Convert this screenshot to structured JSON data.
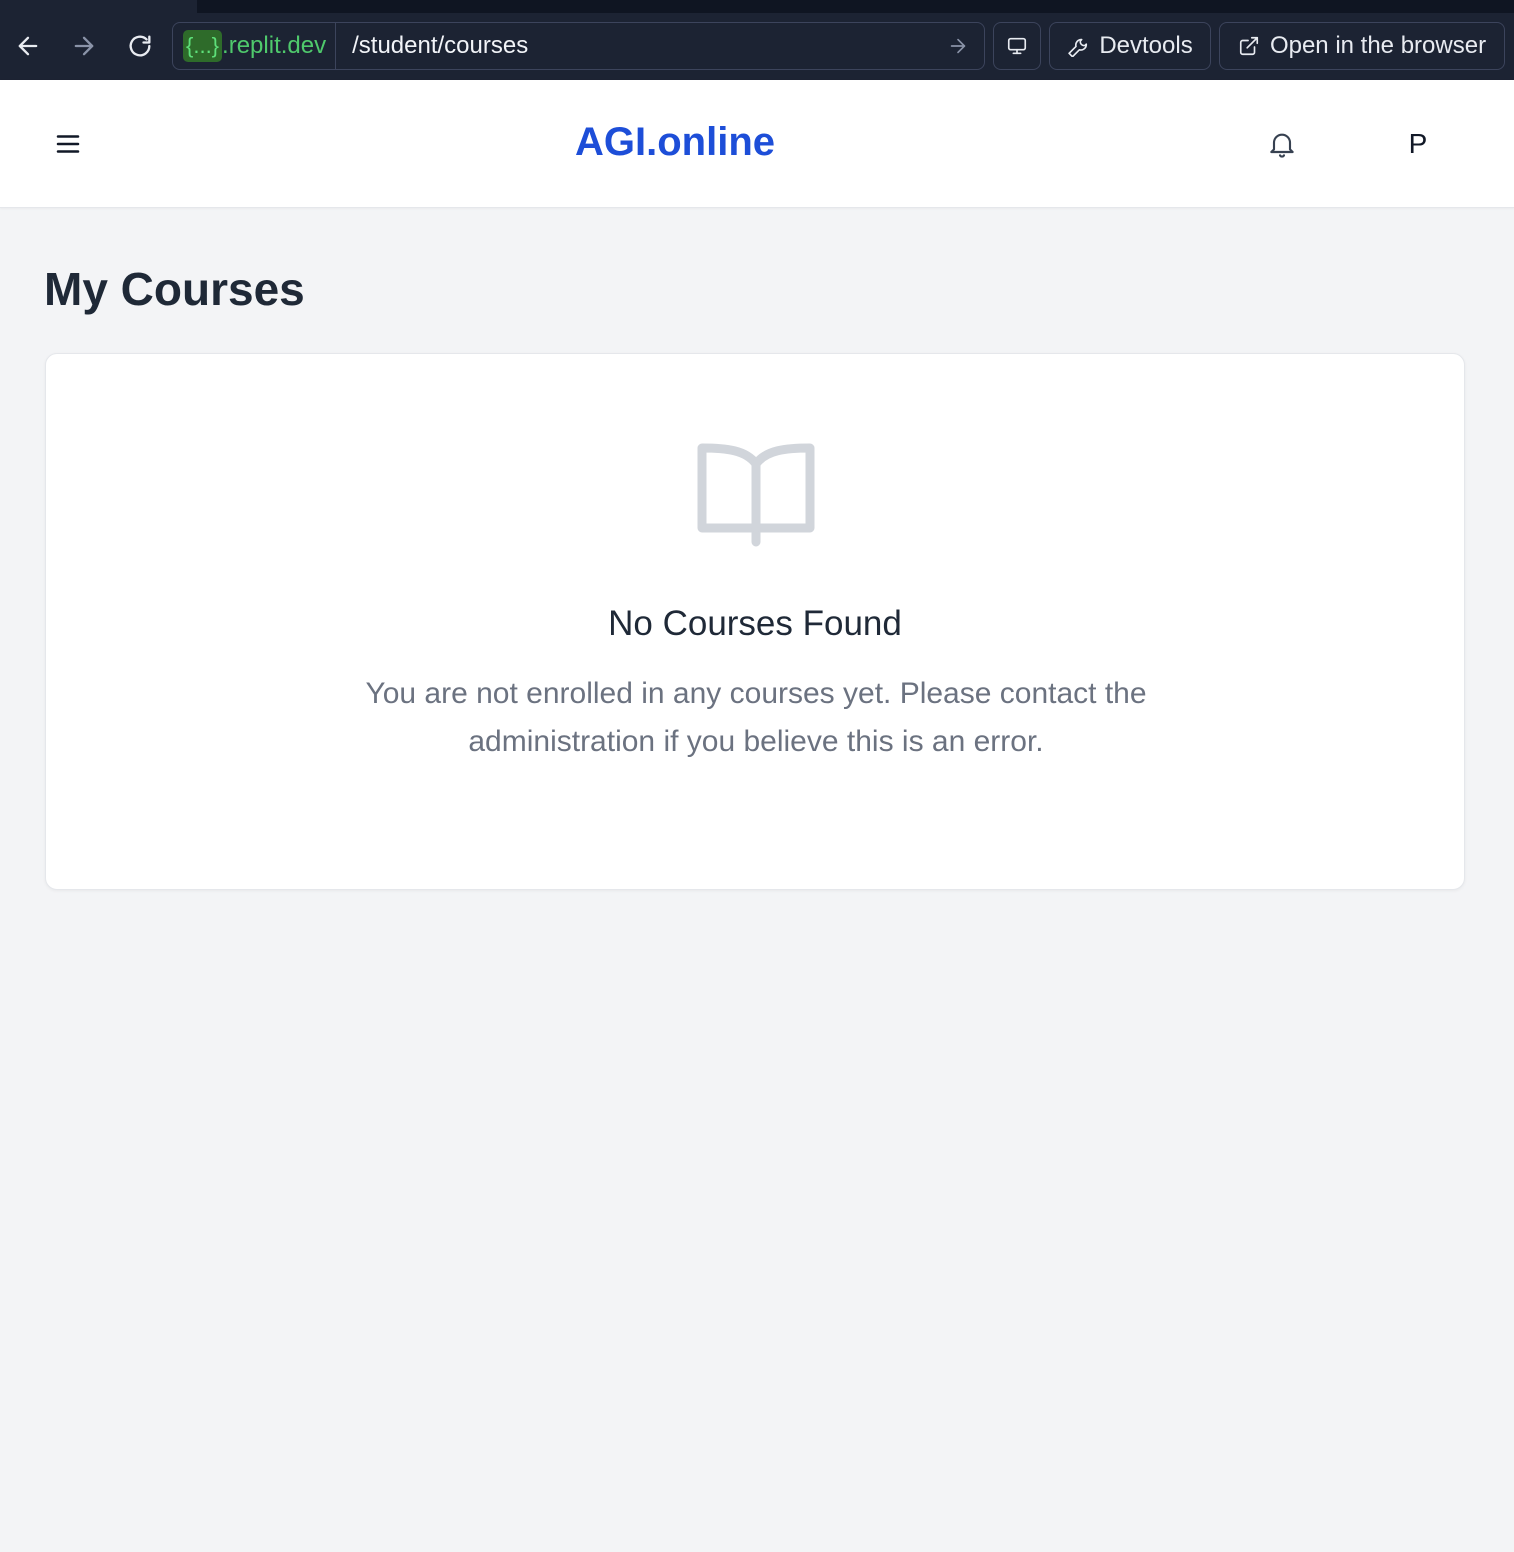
{
  "browser": {
    "host_prefix": "{...}",
    "host_suffix": ".replit.dev",
    "path": "/student/courses",
    "devtools_label": "Devtools",
    "open_browser_label": "Open in the browser"
  },
  "header": {
    "brand": "AGI.online",
    "avatar_initial": "P"
  },
  "main": {
    "title": "My Courses",
    "empty_state": {
      "icon": "open-book-icon",
      "title": "No Courses Found",
      "description": "You are not enrolled in any courses yet. Please contact the administration if you believe this is an error."
    }
  },
  "colors": {
    "brand": "#1d4ed8",
    "chrome_bg": "#1c2333",
    "page_bg": "#f3f4f6",
    "muted_text": "#6b7280",
    "icon_gray": "#d1d5db"
  }
}
